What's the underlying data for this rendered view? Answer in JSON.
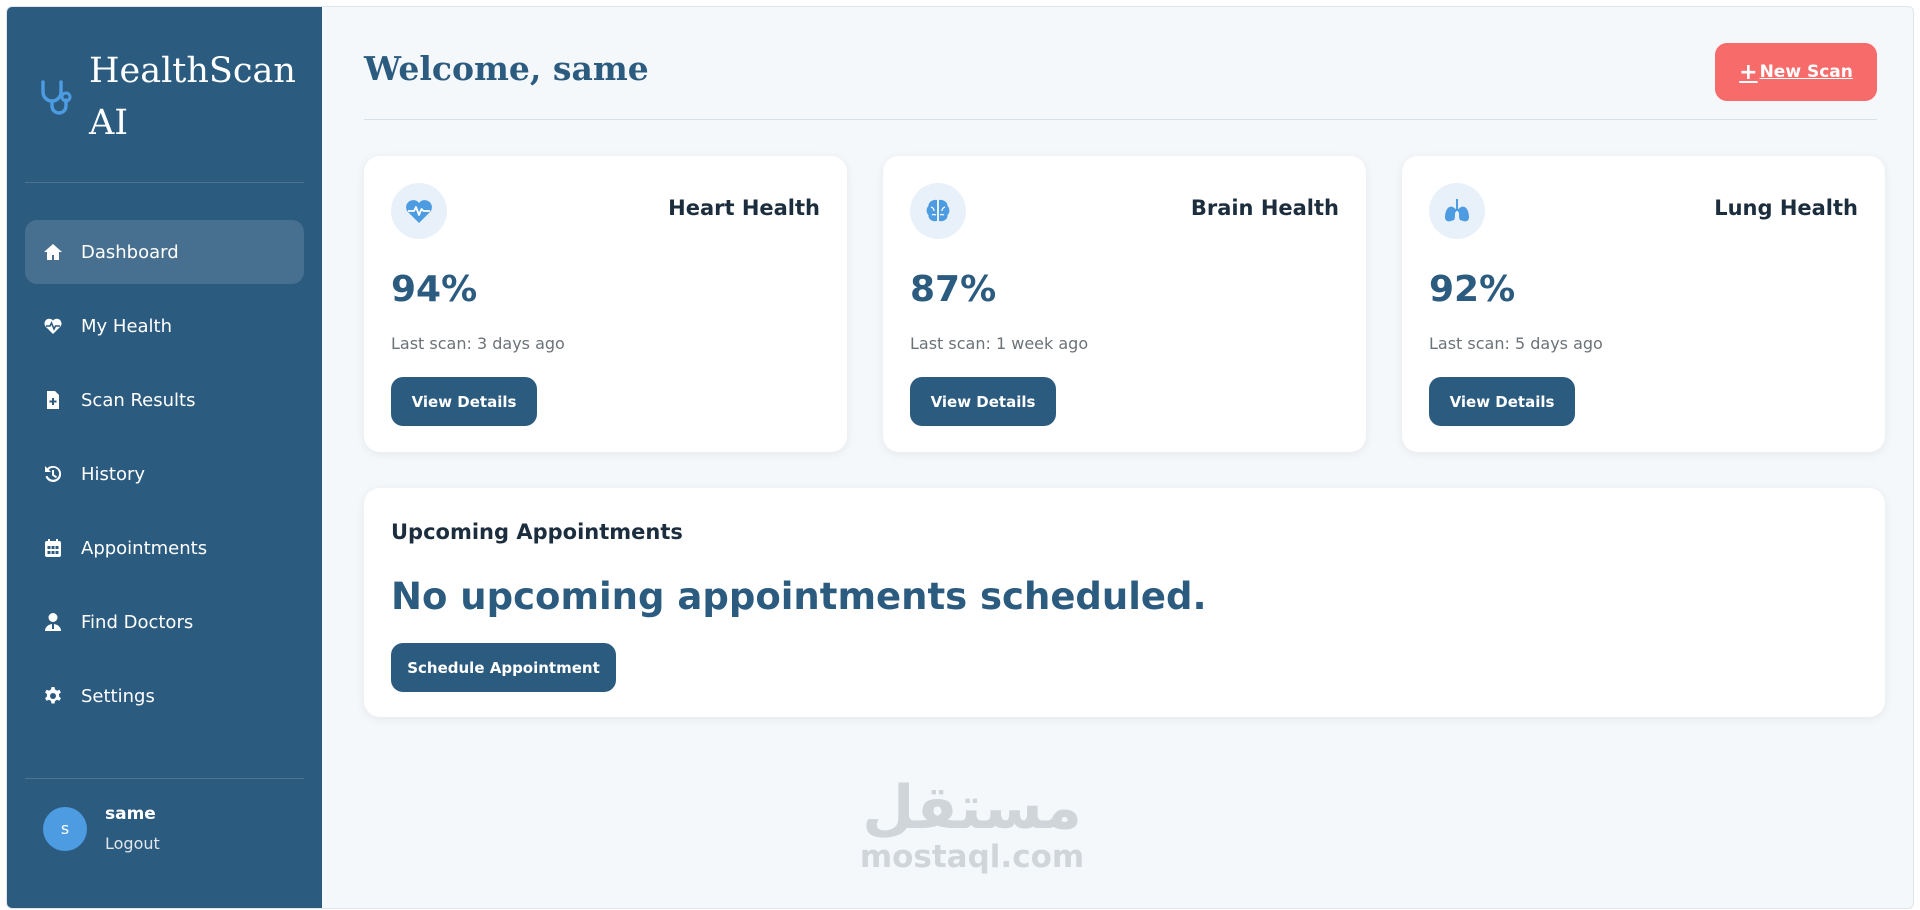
{
  "brand": {
    "name": "HealthScan AI",
    "icon": "stethoscope-icon"
  },
  "sidebar": {
    "items": [
      {
        "label": "Dashboard",
        "icon": "home-icon",
        "active": true
      },
      {
        "label": "My Health",
        "icon": "heart-pulse-icon",
        "active": false
      },
      {
        "label": "Scan Results",
        "icon": "file-medical-icon",
        "active": false
      },
      {
        "label": "History",
        "icon": "history-icon",
        "active": false
      },
      {
        "label": "Appointments",
        "icon": "calendar-icon",
        "active": false
      },
      {
        "label": "Find Doctors",
        "icon": "doctor-icon",
        "active": false
      },
      {
        "label": "Settings",
        "icon": "gear-icon",
        "active": false
      }
    ],
    "user": {
      "avatar_letter": "s",
      "name": "same",
      "logout_label": "Logout"
    }
  },
  "header": {
    "title": "Welcome, same",
    "new_scan_label": "New Scan"
  },
  "cards": [
    {
      "title": "Heart Health",
      "value": "94%",
      "progress_pct": 94,
      "last_scan": "Last scan: 3 days ago",
      "button": "View Details",
      "icon": "heartbeat-icon"
    },
    {
      "title": "Brain Health",
      "value": "87%",
      "progress_pct": 87,
      "last_scan": "Last scan: 1 week ago",
      "button": "View Details",
      "icon": "brain-icon"
    },
    {
      "title": "Lung Health",
      "value": "92%",
      "progress_pct": 92,
      "last_scan": "Last scan: 5 days ago",
      "button": "View Details",
      "icon": "lungs-icon"
    }
  ],
  "appointments": {
    "title": "Upcoming Appointments",
    "empty_message": "No upcoming appointments scheduled.",
    "button": "Schedule Appointment"
  },
  "watermark": {
    "arabic": "مستقل",
    "latin": "mostaql.com"
  },
  "colors": {
    "sidebar_bg": "#2c5b80",
    "accent": "#2c5b80",
    "new_scan_bg": "#f76b6b",
    "icon_blue": "#4d9be0",
    "page_bg": "#f5f8fb"
  }
}
